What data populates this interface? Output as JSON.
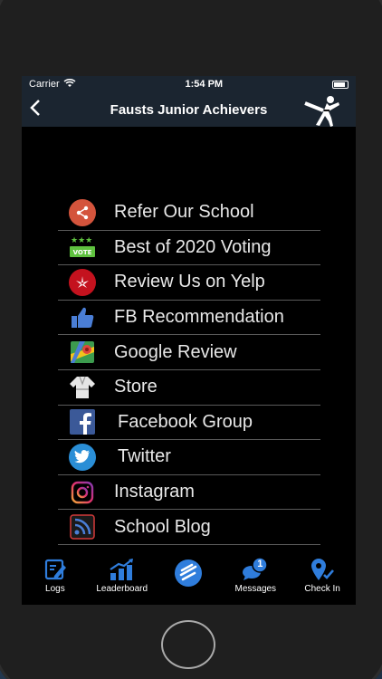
{
  "status": {
    "carrier": "Carrier",
    "time": "1:54 PM"
  },
  "nav": {
    "title": "Fausts Junior Achievers"
  },
  "menu": [
    {
      "label": "Refer Our School",
      "icon": "share-icon"
    },
    {
      "label": "Best of 2020 Voting",
      "icon": "vote-icon"
    },
    {
      "label": "Review Us on Yelp",
      "icon": "yelp-icon"
    },
    {
      "label": "FB Recommendation",
      "icon": "thumbs-up-icon"
    },
    {
      "label": "Google Review",
      "icon": "google-maps-icon"
    },
    {
      "label": "Store",
      "icon": "uniform-icon"
    },
    {
      "label": "Facebook Group",
      "icon": "facebook-icon"
    },
    {
      "label": "Twitter",
      "icon": "twitter-icon"
    },
    {
      "label": "Instagram",
      "icon": "instagram-icon"
    },
    {
      "label": "School Blog",
      "icon": "rss-icon"
    }
  ],
  "tabs": [
    {
      "label": "Logs",
      "icon": "logs-icon"
    },
    {
      "label": "Leaderboard",
      "icon": "leaderboard-icon"
    },
    {
      "label": "",
      "icon": "menu-icon"
    },
    {
      "label": "Messages",
      "icon": "messages-icon"
    },
    {
      "label": "Check In",
      "icon": "check-in-icon"
    }
  ],
  "badge": {
    "messages": "1"
  },
  "colors": {
    "tab_icon": "#2f7ddc",
    "nav_bg": "#1b2530",
    "divider": "#5a5a5a"
  }
}
